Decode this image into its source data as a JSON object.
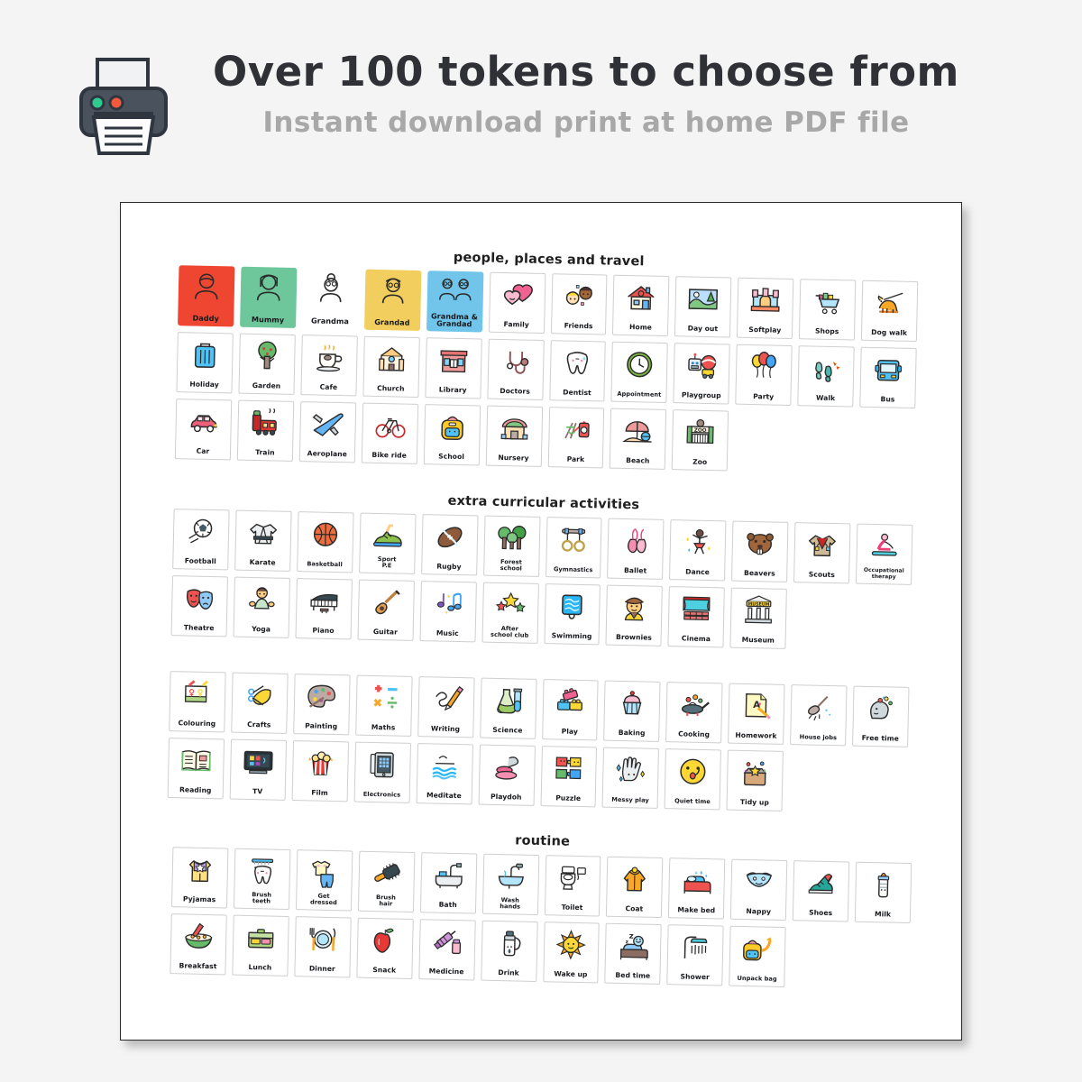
{
  "header": {
    "printer_icon": "printer-icon",
    "title": "Over 100 tokens to choose from",
    "subtitle": "Instant download print at home PDF file"
  },
  "sheet": {
    "sections": [
      {
        "id": "people",
        "heading": "people, places and travel",
        "tokens": [
          {
            "label": "Daddy",
            "icon": "man-face-icon",
            "bg": "#ee4630",
            "outline": true
          },
          {
            "label": "Mummy",
            "icon": "woman-face-icon",
            "bg": "#6ec79a",
            "outline": true
          },
          {
            "label": "Grandma",
            "icon": "grandma-face-icon",
            "bg": "#eda košt"
          },
          {
            "label": "Grandad",
            "icon": "grandad-face-icon",
            "bg": "#f2ce5e"
          },
          {
            "label": "Grandma &\nGrandad",
            "icon": "grandparents-icon",
            "bg": "#72c5ea"
          },
          {
            "label": "Family",
            "icon": "hearts-icon",
            "bg": ""
          },
          {
            "label": "Friends",
            "icon": "two-kids-icon",
            "bg": ""
          },
          {
            "label": "Home",
            "icon": "house-icon",
            "bg": ""
          },
          {
            "label": "Day out",
            "icon": "landscape-picture-icon",
            "bg": ""
          },
          {
            "label": "Softplay",
            "icon": "bouncy-castle-icon",
            "bg": ""
          },
          {
            "label": "Shops",
            "icon": "shopping-trolley-icon",
            "bg": ""
          },
          {
            "label": "Dog walk",
            "icon": "dog-on-lead-icon",
            "bg": ""
          },
          {
            "label": "Holiday",
            "icon": "suitcase-icon",
            "bg": ""
          },
          {
            "label": "Garden",
            "icon": "apple-tree-icon",
            "bg": ""
          },
          {
            "label": "Cafe",
            "icon": "coffee-cup-icon",
            "bg": ""
          },
          {
            "label": "Church",
            "icon": "church-icon",
            "bg": ""
          },
          {
            "label": "Library",
            "icon": "library-building-icon",
            "bg": ""
          },
          {
            "label": "Doctors",
            "icon": "stethoscope-icon",
            "bg": ""
          },
          {
            "label": "Dentist",
            "icon": "tooth-icon",
            "bg": ""
          },
          {
            "label": "Appointment",
            "icon": "clock-icon",
            "bg": ""
          },
          {
            "label": "Playgroup",
            "icon": "robot-toy-icon",
            "bg": ""
          },
          {
            "label": "Party",
            "icon": "balloons-icon",
            "bg": ""
          },
          {
            "label": "Walk",
            "icon": "footprints-icon",
            "bg": ""
          },
          {
            "label": "Bus",
            "icon": "bus-icon",
            "bg": ""
          },
          {
            "label": "Car",
            "icon": "car-icon",
            "bg": ""
          },
          {
            "label": "Train",
            "icon": "steam-train-icon",
            "bg": ""
          },
          {
            "label": "Aeroplane",
            "icon": "aeroplane-icon",
            "bg": ""
          },
          {
            "label": "Bike ride",
            "icon": "bicycle-icon",
            "bg": ""
          },
          {
            "label": "School",
            "icon": "backpack-icon",
            "bg": ""
          },
          {
            "label": "Nursery",
            "icon": "nursery-building-icon",
            "bg": ""
          },
          {
            "label": "Park",
            "icon": "playground-slide-icon",
            "bg": ""
          },
          {
            "label": "Beach",
            "icon": "beach-parasol-icon",
            "bg": ""
          },
          {
            "label": "Zoo",
            "icon": "zoo-gate-icon",
            "bg": ""
          }
        ]
      },
      {
        "id": "extra",
        "heading": "extra curricular activities",
        "tokens": [
          {
            "label": "Football",
            "icon": "football-icon"
          },
          {
            "label": "Karate",
            "icon": "karate-gi-icon"
          },
          {
            "label": "Basketball",
            "icon": "basketball-icon"
          },
          {
            "label": "Sport\nP.E",
            "icon": "trainer-shoe-icon"
          },
          {
            "label": "Rugby",
            "icon": "rugby-ball-icon"
          },
          {
            "label": "Forest\nschool",
            "icon": "trees-icon"
          },
          {
            "label": "Gymnastics",
            "icon": "gym-rings-icon"
          },
          {
            "label": "Ballet",
            "icon": "ballet-shoes-icon"
          },
          {
            "label": "Dance",
            "icon": "dancer-icon"
          },
          {
            "label": "Beavers",
            "icon": "beaver-icon"
          },
          {
            "label": "Scouts",
            "icon": "scout-shirt-icon"
          },
          {
            "label": "Occupational\ntherapy",
            "icon": "stretching-person-icon"
          },
          {
            "label": "Theatre",
            "icon": "theatre-masks-icon"
          },
          {
            "label": "Yoga",
            "icon": "yoga-person-icon"
          },
          {
            "label": "Piano",
            "icon": "piano-icon"
          },
          {
            "label": "Guitar",
            "icon": "guitar-icon"
          },
          {
            "label": "Music",
            "icon": "music-notes-icon"
          },
          {
            "label": "After\nschool club",
            "icon": "stars-icon"
          },
          {
            "label": "Swimming",
            "icon": "swimming-pool-icon"
          },
          {
            "label": "Brownies",
            "icon": "brownie-guide-icon"
          },
          {
            "label": "Cinema",
            "icon": "cinema-screen-icon"
          },
          {
            "label": "Museum",
            "icon": "museum-icon"
          }
        ]
      },
      {
        "id": "learn",
        "heading": "",
        "tokens": [
          {
            "label": "Colouring",
            "icon": "colouring-picture-icon"
          },
          {
            "label": "Crafts",
            "icon": "scissors-craft-icon"
          },
          {
            "label": "Painting",
            "icon": "paint-palette-icon"
          },
          {
            "label": "Maths",
            "icon": "maths-symbols-icon"
          },
          {
            "label": "Writing",
            "icon": "pencil-writing-icon"
          },
          {
            "label": "Science",
            "icon": "test-tubes-icon"
          },
          {
            "label": "Play",
            "icon": "building-bricks-icon"
          },
          {
            "label": "Baking",
            "icon": "cupcake-icon"
          },
          {
            "label": "Cooking",
            "icon": "frying-pan-icon"
          },
          {
            "label": "Homework",
            "icon": "graded-paper-icon"
          },
          {
            "label": "House jobs",
            "icon": "broom-icon"
          },
          {
            "label": "Free time",
            "icon": "head-ideas-icon"
          },
          {
            "label": "Reading",
            "icon": "open-book-icon"
          },
          {
            "label": "TV",
            "icon": "television-icon"
          },
          {
            "label": "Film",
            "icon": "popcorn-icon"
          },
          {
            "label": "Electronics",
            "icon": "tablet-icon"
          },
          {
            "label": "Meditate",
            "icon": "calm-waves-icon"
          },
          {
            "label": "Playdoh",
            "icon": "playdough-icon"
          },
          {
            "label": "Puzzle",
            "icon": "jigsaw-puzzle-icon"
          },
          {
            "label": "Messy play",
            "icon": "messy-hand-icon"
          },
          {
            "label": "Quiet time",
            "icon": "shush-face-icon"
          },
          {
            "label": "Tidy up",
            "icon": "toy-box-icon"
          }
        ]
      },
      {
        "id": "routine",
        "heading": "routine",
        "tokens": [
          {
            "label": "Pyjamas",
            "icon": "pyjamas-icon"
          },
          {
            "label": "Brush\nteeth",
            "icon": "toothbrush-tooth-icon"
          },
          {
            "label": "Get\ndressed",
            "icon": "clothes-icon"
          },
          {
            "label": "Brush\nhair",
            "icon": "hairbrush-icon"
          },
          {
            "label": "Bath",
            "icon": "bathtub-icon"
          },
          {
            "label": "Wash\nhands",
            "icon": "sink-taps-icon"
          },
          {
            "label": "Toilet",
            "icon": "toilet-icon"
          },
          {
            "label": "Coat",
            "icon": "raincoat-icon"
          },
          {
            "label": "Make bed",
            "icon": "bed-made-icon"
          },
          {
            "label": "Nappy",
            "icon": "nappy-icon"
          },
          {
            "label": "Shoes",
            "icon": "shoe-icon"
          },
          {
            "label": "Milk",
            "icon": "baby-bottle-icon"
          },
          {
            "label": "Breakfast",
            "icon": "cereal-bowl-icon"
          },
          {
            "label": "Lunch",
            "icon": "lunchbox-icon"
          },
          {
            "label": "Dinner",
            "icon": "plate-cutlery-icon"
          },
          {
            "label": "Snack",
            "icon": "apple-icon"
          },
          {
            "label": "Medicine",
            "icon": "syringe-medicine-icon"
          },
          {
            "label": "Drink",
            "icon": "water-bottle-icon"
          },
          {
            "label": "Wake up",
            "icon": "sun-icon"
          },
          {
            "label": "Bed time",
            "icon": "sleeping-person-icon"
          },
          {
            "label": "Shower",
            "icon": "shower-icon"
          },
          {
            "label": "Unpack bag",
            "icon": "backpack-arrow-icon"
          }
        ]
      }
    ]
  },
  "colors": {
    "page_bg": "#f4f4f4",
    "sheet_bg": "#ffffff",
    "title": "#2f3136",
    "subtitle": "#a8a8a8",
    "token_border": "#cfcfcf",
    "daddy_bg": "#ee4630",
    "mummy_bg": "#6ec79a",
    "grandma_bg": "#eda45a",
    "grandad_bg": "#f2ce5e",
    "grandparents_bg": "#72c5ea"
  }
}
